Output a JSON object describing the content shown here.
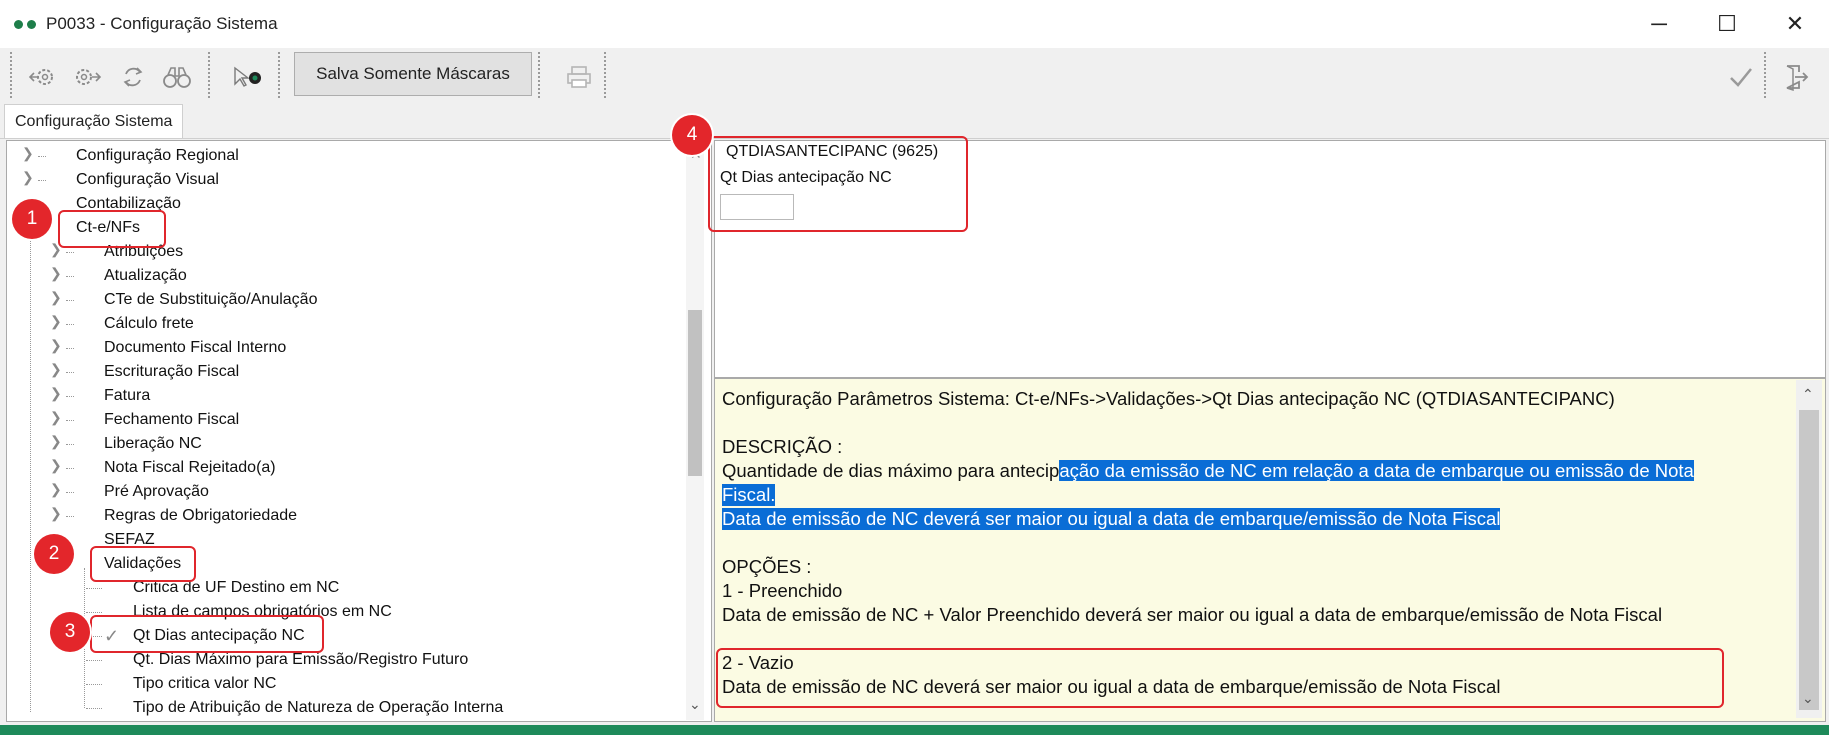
{
  "window": {
    "title": "P0033 - Configuração Sistema",
    "controls": {
      "minimize": "─",
      "maximize": "☐",
      "close": "✕"
    }
  },
  "toolbar": {
    "icons": [
      "gear-left-arrow-icon",
      "gear-right-arrow-icon",
      "refresh-icon",
      "binoculars-icon",
      "cursor-record-icon"
    ],
    "masks_button": "Salva Somente Máscaras",
    "print_icon": "printer-icon",
    "confirm_icon": "checkmark-icon",
    "exit_icon": "exit-door-icon"
  },
  "tabs": [
    "Configuração Sistema"
  ],
  "tree": {
    "top_items": [
      "Configuração Regional",
      "Configuração Visual",
      "Contabilização"
    ],
    "expanded": "Ct-e/NFs",
    "children": [
      "Atribuições",
      "Atualização",
      "CTe de Substituição/Anulação",
      "Cálculo frete",
      "Documento Fiscal Interno",
      "Escrituração Fiscal",
      "Fatura",
      "Fechamento Fiscal",
      "Liberação NC",
      "Nota Fiscal Rejeitado(a)",
      "Pré Aprovação",
      "Regras de Obrigatoriedade",
      "SEFAZ"
    ],
    "validacoes": "Validações",
    "validacoes_children": [
      "Critica de UF Destino em NC",
      "Lista de campos obrigatórios em NC",
      "Qt Dias antecipação NC",
      "Qt. Dias Máximo para Emissão/Registro Futuro",
      "Tipo critica valor NC",
      "Tipo de Atribuição de Natureza de Operação Interna"
    ],
    "selected_check": "✓"
  },
  "param": {
    "group_title": "QTDIASANTECIPANC (9625)",
    "label": "Qt Dias antecipação NC",
    "value": ""
  },
  "description": {
    "header": "Configuração Parâmetros Sistema: Ct-e/NFs->Validações->Qt Dias antecipação NC (QTDIASANTECIPANC)",
    "desc_title": "DESCRIÇÃO :",
    "line1_a": "Quantidade de dias máximo para antecip",
    "line1_b": "ação da emissão de NC em relação a data de embarque ou emissão de Nota",
    "line2": "Fiscal.",
    "line3": "Data de emissão de NC deverá ser maior ou igual a data de embarque/emissão de Nota Fiscal",
    "options_title": "OPÇÕES :",
    "opt1_title": "1 - Preenchido",
    "opt1_text": "Data de emissão de NC + Valor Preenchido deverá ser maior ou igual a data de embarque/emissão de Nota Fiscal",
    "opt2_title": "2 - Vazio",
    "opt2_text": "Data de emissão de NC deverá ser maior ou igual a data de embarque/emissão de Nota Fiscal"
  },
  "callouts": [
    "1",
    "2",
    "3",
    "4"
  ],
  "colors": {
    "callout": "#e3262b",
    "selection": "#0a6dd6",
    "desc_bg": "#fbfbe3"
  }
}
